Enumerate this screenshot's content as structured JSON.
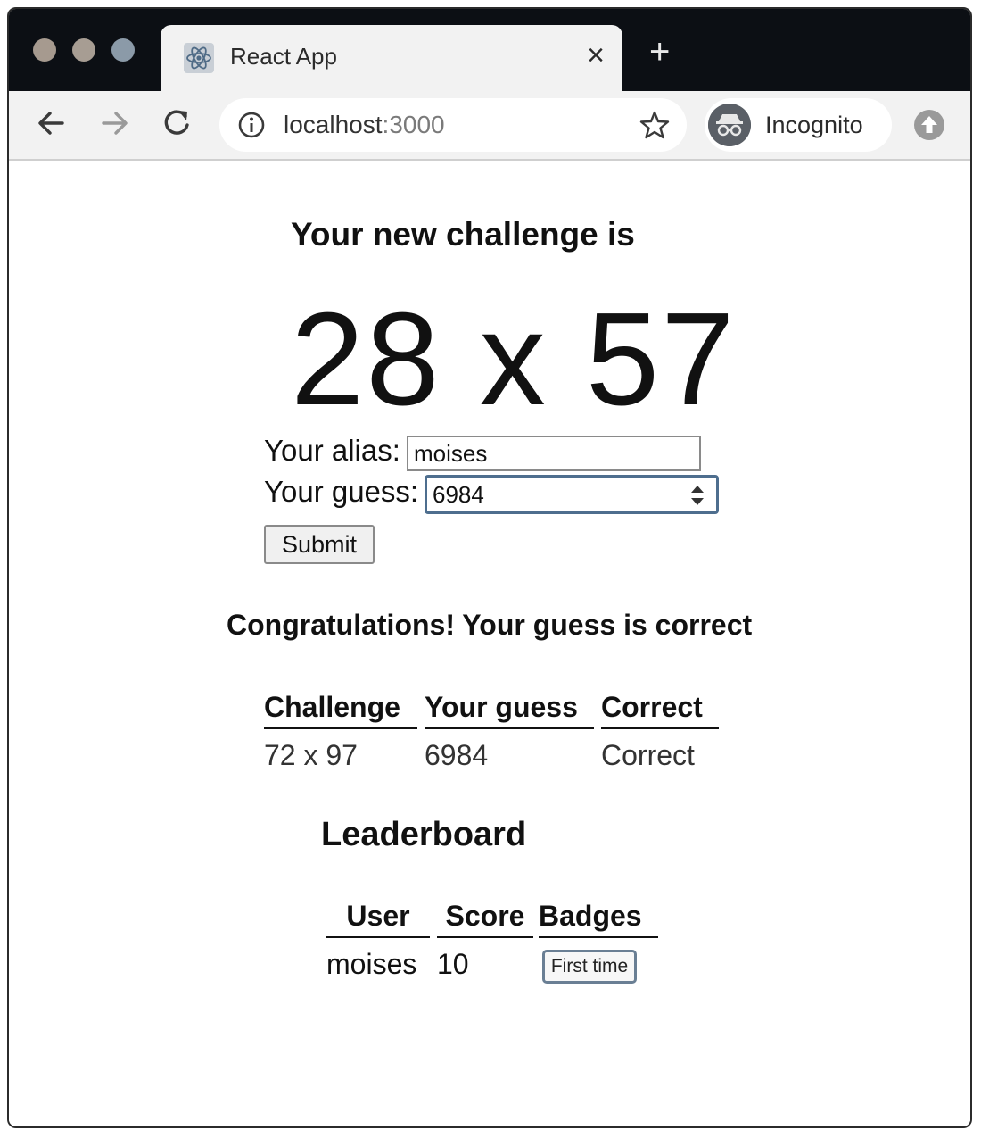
{
  "browser": {
    "tab_title": "React App",
    "tab_close": "×",
    "new_tab": "+",
    "url_host": "localhost",
    "url_port": ":3000",
    "incognito_label": "Incognito"
  },
  "page": {
    "heading": "Your new challenge is",
    "challenge": "28 x 57",
    "form": {
      "alias_label": "Your alias:",
      "alias_value": "moises",
      "guess_label": "Your guess:",
      "guess_value": "6984",
      "submit_label": "Submit"
    },
    "result_message": "Congratulations! Your guess is correct",
    "attempts_table": {
      "headers": [
        "Challenge",
        "Your guess",
        "Correct"
      ],
      "rows": [
        [
          "72 x 97",
          "6984",
          "Correct"
        ]
      ]
    },
    "leaderboard": {
      "title": "Leaderboard",
      "headers": [
        "User",
        "Score",
        "Badges"
      ],
      "rows": [
        {
          "user": "moises",
          "score": "10",
          "badge": "First time"
        }
      ]
    }
  }
}
